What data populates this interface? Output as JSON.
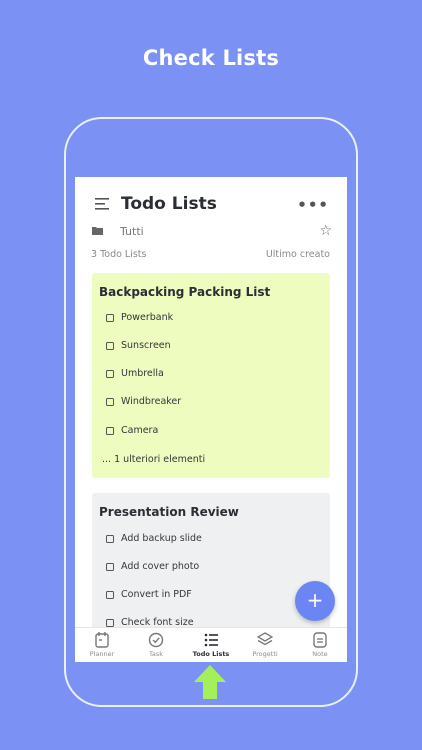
{
  "headline": "Check Lists",
  "header": {
    "title": "Todo Lists",
    "more": "•••"
  },
  "folder": {
    "label": "Tutti"
  },
  "meta": {
    "count": "3 Todo Lists",
    "sort": "Ultimo creato"
  },
  "lists": [
    {
      "title": "Backpacking Packing List",
      "items": [
        "Powerbank",
        "Sunscreen",
        "Umbrella",
        "Windbreaker",
        "Camera"
      ],
      "more": "... 1 ulteriori elementi"
    },
    {
      "title": "Presentation Review",
      "items": [
        "Add backup slide",
        "Add cover photo",
        "Convert in PDF",
        "Check font size"
      ]
    }
  ],
  "fab": {
    "label": "+"
  },
  "tabs": [
    {
      "label": "Planner",
      "icon": "planner-icon"
    },
    {
      "label": "Task",
      "icon": "task-check-icon"
    },
    {
      "label": "Todo Lists",
      "icon": "list-icon",
      "active": true
    },
    {
      "label": "Progetti",
      "icon": "layers-icon"
    },
    {
      "label": "Note",
      "icon": "note-icon"
    }
  ],
  "colors": {
    "background": "#7b91f4",
    "card_yellow": "#eefcc0",
    "card_gray": "#eff0f2",
    "fab": "#6b86f2",
    "arrow": "#a4f05a"
  }
}
